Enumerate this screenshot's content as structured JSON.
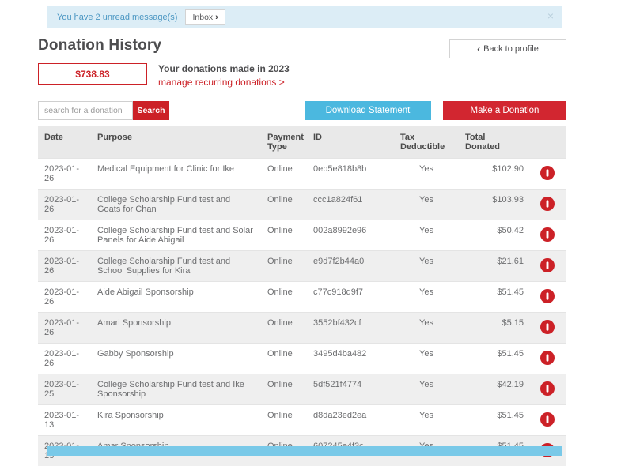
{
  "banner": {
    "text": "You have 2 unread message(s)",
    "inbox_label": "Inbox",
    "chevron_right": "›",
    "close": "×"
  },
  "header": {
    "title": "Donation History",
    "back_chevron": "‹",
    "back_label": "Back to profile"
  },
  "summary": {
    "total_amount": "$738.83",
    "caption": "Your donations made in 2023",
    "manage_link": "manage recurring donations >"
  },
  "toolbar": {
    "search_placeholder": "search for a donation",
    "search_label": "Search",
    "download_label": "Download Statement",
    "donate_label": "Make a Donation"
  },
  "table": {
    "columns": [
      "Date",
      "Purpose",
      "Payment Type",
      "ID",
      "Tax Deductible",
      "Total Donated"
    ],
    "rows": [
      {
        "date": "2023-01-26",
        "purpose": "Medical Equipment for Clinic for Ike",
        "payment": "Online",
        "id": "0eb5e818b8b",
        "tax": "Yes",
        "total": "$102.90"
      },
      {
        "date": "2023-01-26",
        "purpose": "College Scholarship Fund test and Goats for Chan",
        "payment": "Online",
        "id": "ccc1a824f61",
        "tax": "Yes",
        "total": "$103.93"
      },
      {
        "date": "2023-01-26",
        "purpose": "College Scholarship Fund test and Solar Panels for Aide Abigail",
        "payment": "Online",
        "id": "002a8992e96",
        "tax": "Yes",
        "total": "$50.42"
      },
      {
        "date": "2023-01-26",
        "purpose": "College Scholarship Fund test and School Supplies for Kira",
        "payment": "Online",
        "id": "e9d7f2b44a0",
        "tax": "Yes",
        "total": "$21.61"
      },
      {
        "date": "2023-01-26",
        "purpose": "Aide Abigail Sponsorship",
        "payment": "Online",
        "id": "c77c918d9f7",
        "tax": "Yes",
        "total": "$51.45"
      },
      {
        "date": "2023-01-26",
        "purpose": "Amari Sponsorship",
        "payment": "Online",
        "id": "3552bf432cf",
        "tax": "Yes",
        "total": "$5.15"
      },
      {
        "date": "2023-01-26",
        "purpose": "Gabby Sponsorship",
        "payment": "Online",
        "id": "3495d4ba482",
        "tax": "Yes",
        "total": "$51.45"
      },
      {
        "date": "2023-01-25",
        "purpose": "College Scholarship Fund test and Ike Sponsorship",
        "payment": "Online",
        "id": "5df521f4774",
        "tax": "Yes",
        "total": "$42.19"
      },
      {
        "date": "2023-01-13",
        "purpose": "Kira Sponsorship",
        "payment": "Online",
        "id": "d8da23ed2ea",
        "tax": "Yes",
        "total": "$51.45"
      },
      {
        "date": "2023-01-13",
        "purpose": "Amar Sponsorship",
        "payment": "Online",
        "id": "607245e4f3c",
        "tax": "Yes",
        "total": "$51.45"
      }
    ]
  },
  "icons": {
    "row_action": "info-icon",
    "inbox_chevron": "chevron-right-icon",
    "back_chevron": "chevron-left-icon",
    "banner_close": "close-icon"
  },
  "colors": {
    "accent_red": "#cc2127",
    "donate_red": "#d22630",
    "accent_blue": "#4bb8df",
    "banner_bg": "#dcedf6",
    "banner_text": "#4a96c2",
    "id_red": "#cc3333",
    "row_alt_bg": "#efefef",
    "bottom_banner_blue": "#79c9e8"
  }
}
